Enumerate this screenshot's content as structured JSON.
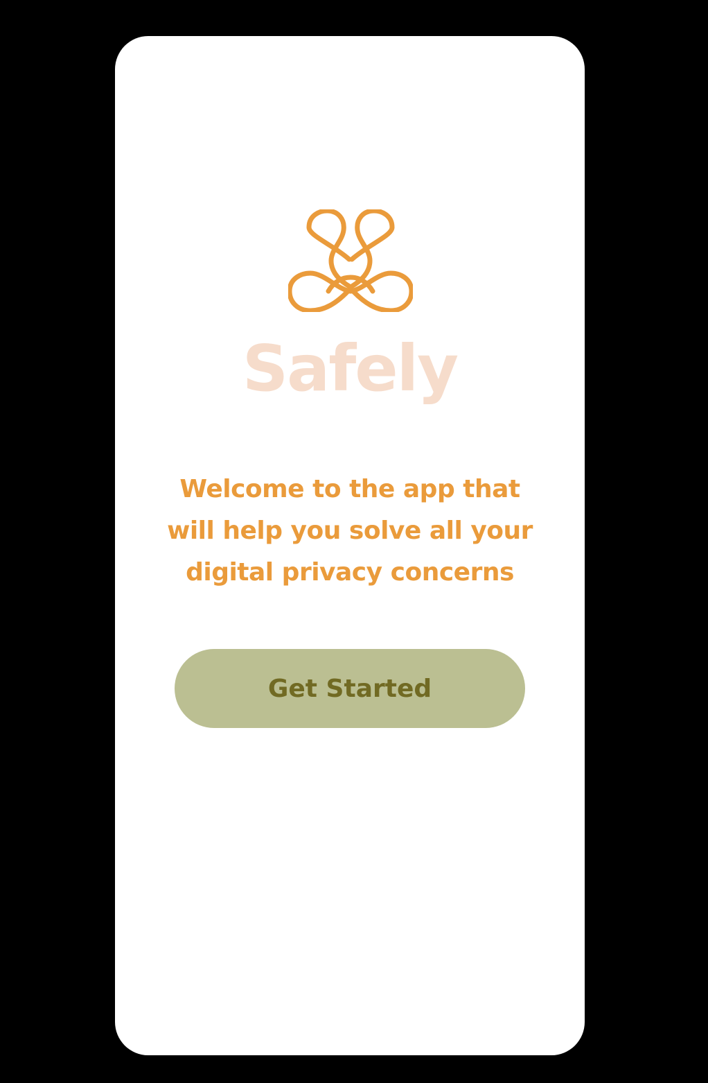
{
  "colors": {
    "background": "#000000",
    "screen": "#ffffff",
    "accent": "#ea9b3b",
    "title": "#f6dccb",
    "button_bg": "#bbbf92",
    "button_text": "#716a23"
  },
  "logo": {
    "icon": "knotted-loops-logo-icon"
  },
  "app_name": "Safely",
  "welcome_text": "Welcome to the app that will help you solve all your digital privacy concerns",
  "cta": {
    "label": "Get Started"
  }
}
